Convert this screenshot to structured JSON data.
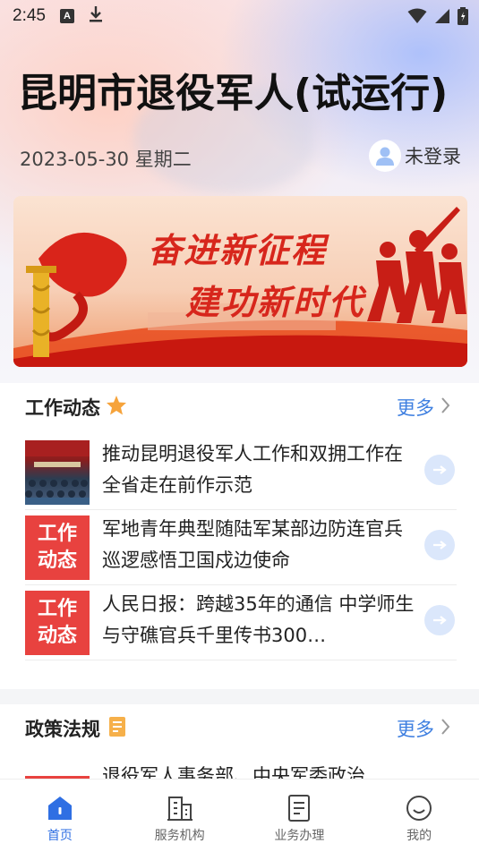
{
  "status_bar": {
    "time": "2:45",
    "a_badge": "A"
  },
  "header": {
    "title": "昆明市退役军人(试运行)",
    "date": "2023-05-30 星期二",
    "login": "未登录"
  },
  "banner": {
    "slogan_line1": "奋进新征程",
    "slogan_line2": "建功新时代"
  },
  "news_section": {
    "title": "工作动态",
    "more": "更多",
    "items": [
      {
        "title": "推动昆明退役军人工作和双拥工作在全省走在前作示范",
        "thumb": "photo",
        "tag": ""
      },
      {
        "title": "军地青年典型随陆军某部边防连官兵巡逻感悟卫国戍边使命",
        "thumb": "tag",
        "tag_line1": "工作",
        "tag_line2": "动态"
      },
      {
        "title": "人民日报：跨越35年的通信 中学师生与守礁官兵千里传书300…",
        "thumb": "tag",
        "tag_line1": "工作",
        "tag_line2": "动态"
      }
    ]
  },
  "policy_section": {
    "title": "政策法规",
    "more": "更多",
    "first_item": "退役军人事务部、中央军委政治"
  },
  "tabs": [
    {
      "label": "首页",
      "icon": "home-icon",
      "active": true
    },
    {
      "label": "服务机构",
      "icon": "building-icon",
      "active": false
    },
    {
      "label": "业务办理",
      "icon": "document-icon",
      "active": false
    },
    {
      "label": "我的",
      "icon": "smiley-icon",
      "active": false
    }
  ],
  "colors": {
    "accent": "#3e7fe0",
    "active_tab": "#2f6fe3",
    "tag_red": "#e8423f",
    "slogan_red": "#d7261c"
  }
}
